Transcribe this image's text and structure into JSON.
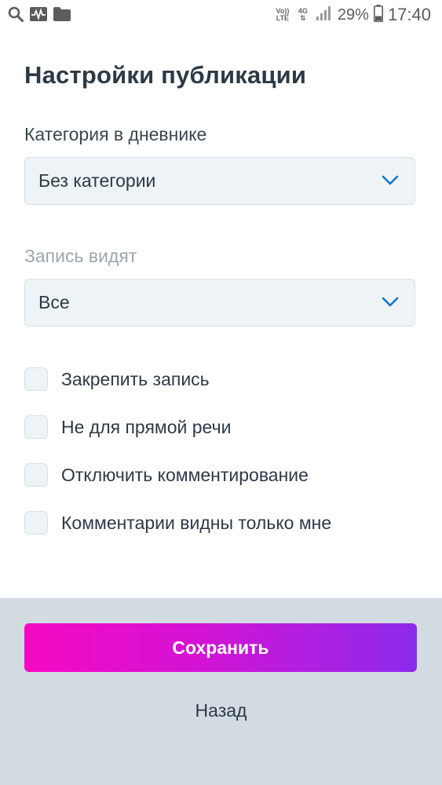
{
  "status_bar": {
    "network_volte": "Vo))",
    "network_lte": "LTE",
    "network_4g": "4G",
    "battery_percent": "29%",
    "time": "17:40",
    "icons": [
      "search-icon",
      "activity-icon",
      "folder-icon",
      "signal-icon",
      "battery-icon"
    ]
  },
  "page": {
    "title": "Настройки публикации"
  },
  "category": {
    "label": "Категория в дневнике",
    "value": "Без категории"
  },
  "visibility": {
    "label": "Запись видят",
    "value": "Все"
  },
  "options": [
    {
      "label": "Закрепить запись",
      "checked": false
    },
    {
      "label": "Не для прямой речи",
      "checked": false
    },
    {
      "label": "Отключить комментирование",
      "checked": false
    },
    {
      "label": "Комментарии видны только мне",
      "checked": false
    }
  ],
  "footer": {
    "save_label": "Сохранить",
    "back_label": "Назад"
  },
  "colors": {
    "accent": "#1a73c8",
    "gradient_start": "#f60ac3",
    "gradient_end": "#8d2bec",
    "footer_bg": "#d2dbe1",
    "field_bg": "#eef3f6"
  }
}
